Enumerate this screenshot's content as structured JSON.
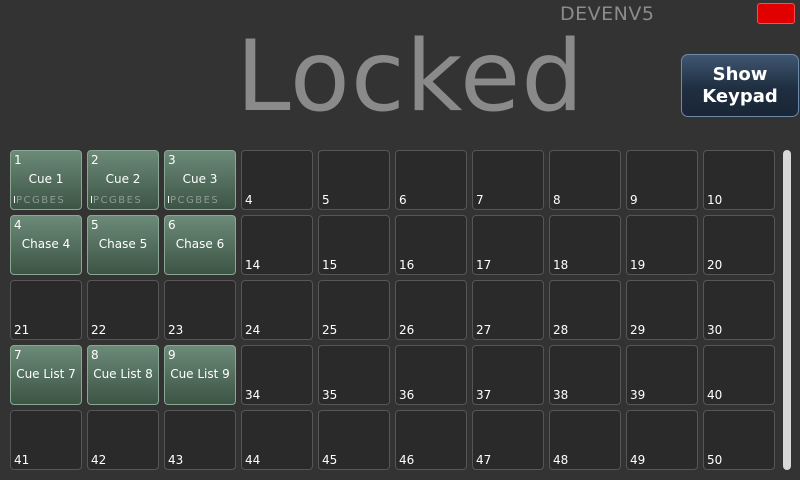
{
  "header": {
    "device_name": "DEVENV5",
    "title": "Locked",
    "keypad_button_label": "Show\nKeypad"
  },
  "colors": {
    "status_indicator": "#e00000",
    "filled_cell": "#4f6a59",
    "background": "#333333"
  },
  "cells": [
    {
      "n": "1",
      "label": "Cue 1",
      "flags": {
        "i": "I",
        "rest": "PCGBES"
      }
    },
    {
      "n": "2",
      "label": "Cue 2",
      "flags": {
        "i": "I",
        "rest": "PCGBES"
      }
    },
    {
      "n": "3",
      "label": "Cue 3",
      "flags": {
        "i": "I",
        "rest": "PCGBES"
      }
    },
    {
      "n": "4"
    },
    {
      "n": "5"
    },
    {
      "n": "6"
    },
    {
      "n": "7"
    },
    {
      "n": "8"
    },
    {
      "n": "9"
    },
    {
      "n": "10"
    },
    {
      "n": "4",
      "label": "Chase 4"
    },
    {
      "n": "5",
      "label": "Chase 5"
    },
    {
      "n": "6",
      "label": "Chase 6"
    },
    {
      "n": "14"
    },
    {
      "n": "15"
    },
    {
      "n": "16"
    },
    {
      "n": "17"
    },
    {
      "n": "18"
    },
    {
      "n": "19"
    },
    {
      "n": "20"
    },
    {
      "n": "21"
    },
    {
      "n": "22"
    },
    {
      "n": "23"
    },
    {
      "n": "24"
    },
    {
      "n": "25"
    },
    {
      "n": "26"
    },
    {
      "n": "27"
    },
    {
      "n": "28"
    },
    {
      "n": "29"
    },
    {
      "n": "30"
    },
    {
      "n": "7",
      "label": "Cue List 7"
    },
    {
      "n": "8",
      "label": "Cue List 8"
    },
    {
      "n": "9",
      "label": "Cue List 9"
    },
    {
      "n": "34"
    },
    {
      "n": "35"
    },
    {
      "n": "36"
    },
    {
      "n": "37"
    },
    {
      "n": "38"
    },
    {
      "n": "39"
    },
    {
      "n": "40"
    },
    {
      "n": "41"
    },
    {
      "n": "42"
    },
    {
      "n": "43"
    },
    {
      "n": "44"
    },
    {
      "n": "45"
    },
    {
      "n": "46"
    },
    {
      "n": "47"
    },
    {
      "n": "48"
    },
    {
      "n": "49"
    },
    {
      "n": "50"
    }
  ]
}
